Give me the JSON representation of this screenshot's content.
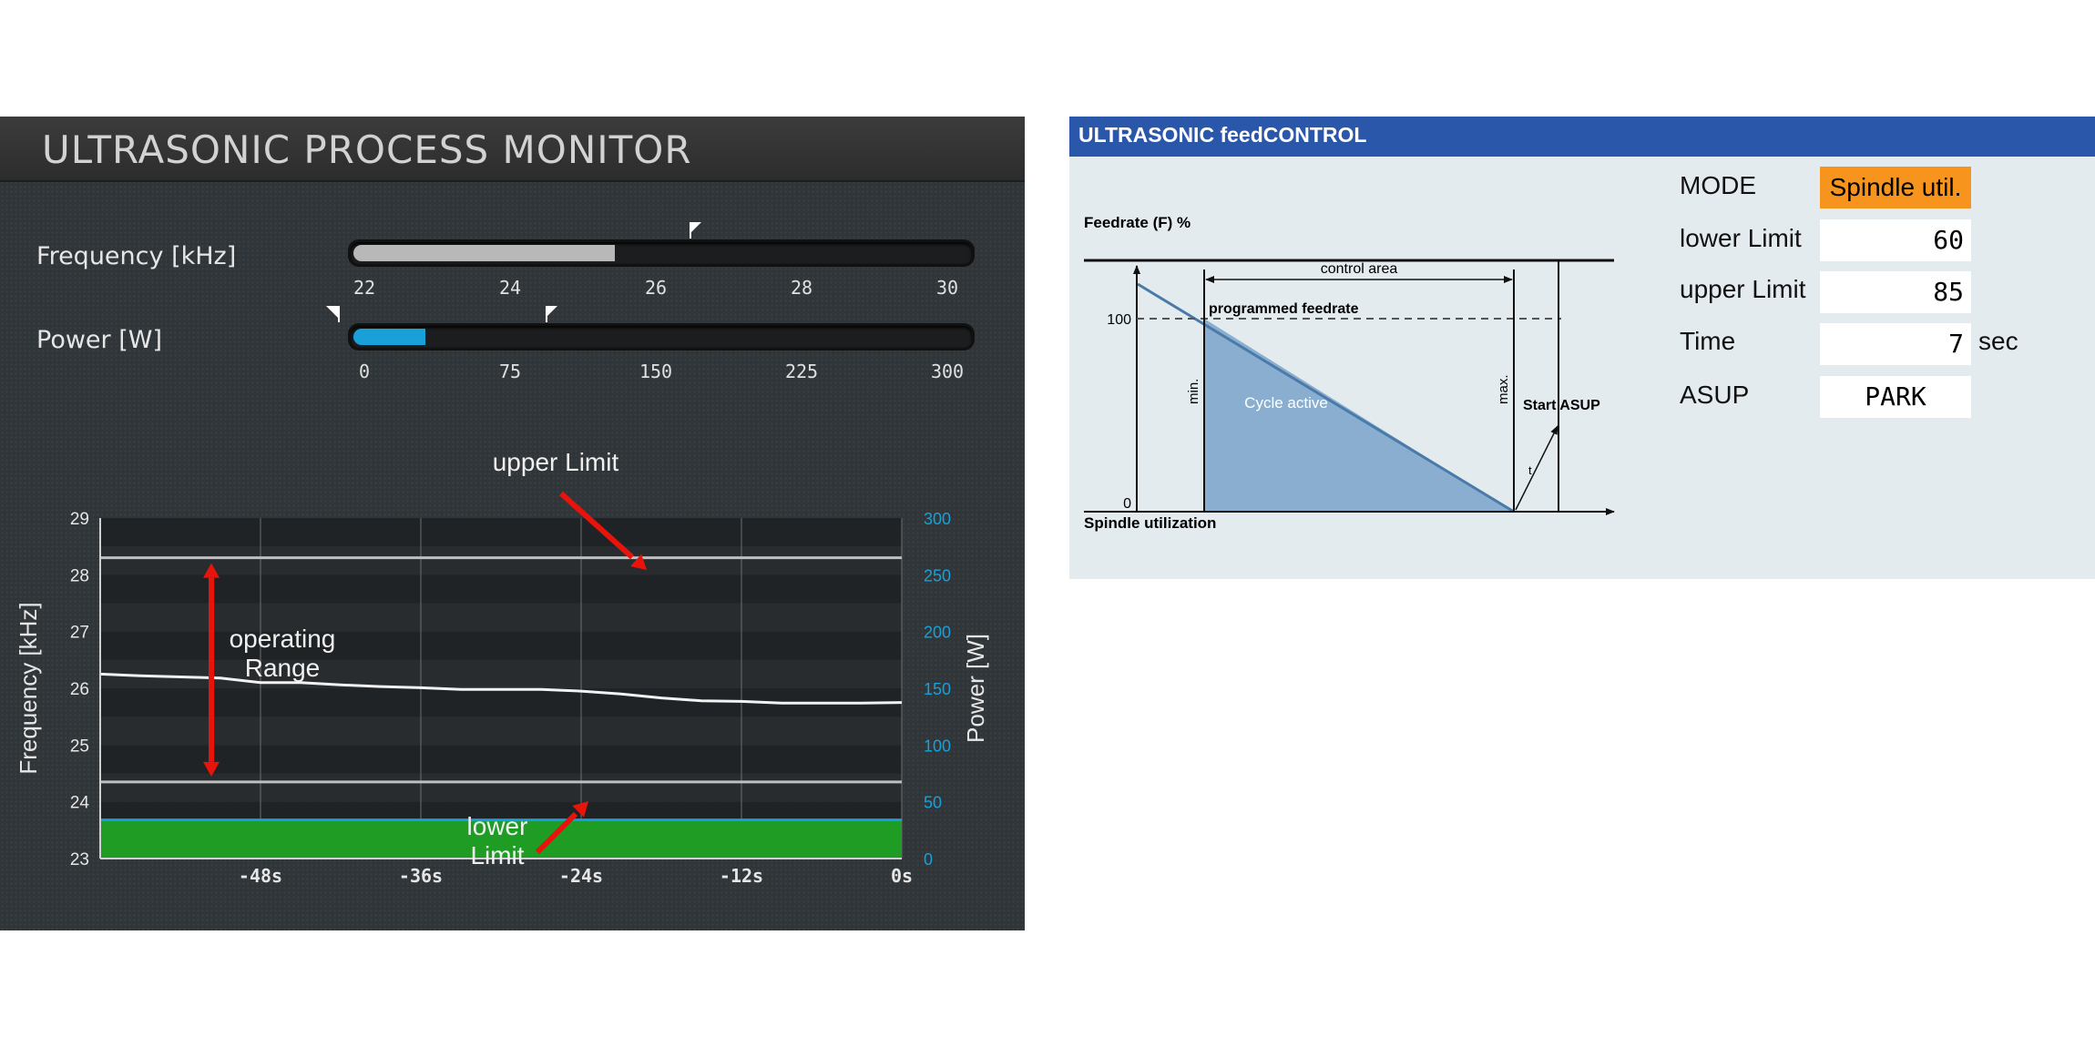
{
  "monitor": {
    "title": "ULTRASONIC PROCESS MONITOR",
    "frequency_gauge": {
      "label": "Frequency [kHz]",
      "ticks": [
        "22",
        "24",
        "26",
        "28",
        "30"
      ],
      "min": 22,
      "max": 30,
      "value": 25.4,
      "limit_marker": 26.4,
      "fill_color": "#b8b8b8"
    },
    "power_gauge": {
      "label": "Power [W]",
      "ticks": [
        "0",
        "75",
        "150",
        "225",
        "300"
      ],
      "min": 0,
      "max": 300,
      "value": 35,
      "lower_marker": 0,
      "upper_marker": 95,
      "fill_color": "#1aa0d8"
    },
    "annotations": {
      "upper_limit": "upper Limit",
      "operating_range_line1": "operating",
      "operating_range_line2": "Range",
      "lower_limit_line1": "lower",
      "lower_limit_line2": "Limit"
    },
    "colors": {
      "power_fill": "#1e9c23",
      "power_axis": "#1aa0d8",
      "arrow": "#e8140c"
    }
  },
  "chart_data": {
    "type": "line",
    "xlabel": "",
    "ylabel": "Frequency [kHz]",
    "y2label": "Power [W]",
    "x_ticks": [
      "-48s",
      "-36s",
      "-24s",
      "-12s",
      "0s"
    ],
    "xlim": [
      -60,
      0
    ],
    "ylim": [
      23,
      29
    ],
    "y_ticks": [
      "23",
      "24",
      "25",
      "26",
      "27",
      "28",
      "29"
    ],
    "y2lim": [
      0,
      300
    ],
    "y2_ticks": [
      "0",
      "50",
      "100",
      "150",
      "200",
      "250",
      "300"
    ],
    "upper_limit": 28.3,
    "lower_limit": 24.35,
    "series": [
      {
        "x": [
          -60,
          -57,
          -54,
          -51,
          -48,
          -45,
          -42,
          -39,
          -36,
          -33,
          -30,
          -27,
          -24,
          -21,
          -18,
          -15,
          -12,
          -9,
          -6,
          -3,
          0
        ],
        "values": [
          26.25,
          26.22,
          26.2,
          26.18,
          26.1,
          26.1,
          26.06,
          26.03,
          26.01,
          25.98,
          25.98,
          25.98,
          25.95,
          25.9,
          25.83,
          25.78,
          25.77,
          25.74,
          25.74,
          25.74,
          25.75
        ]
      },
      {
        "x": [
          -60,
          0
        ],
        "values": [
          34,
          34
        ]
      }
    ]
  },
  "feedcontrol": {
    "title": "ULTRASONIC feedCONTROL",
    "diagram": {
      "y_axis_label": "Feedrate (F) %",
      "x_axis_label": "Spindle utilization",
      "y100": "100",
      "y0": "0",
      "control_area": "control area",
      "programmed_feedrate": "programmed feedrate",
      "min": "min.",
      "max": "max.",
      "cycle_active": "Cycle active",
      "start_asup": "Start ASUP",
      "t": "t"
    },
    "params": {
      "mode_label": "MODE",
      "mode_value": "Spindle util.",
      "lower_label": "lower Limit",
      "lower_value": "60",
      "upper_label": "upper Limit",
      "upper_value": "85",
      "time_label": "Time",
      "time_value": "7",
      "time_unit": "sec",
      "asup_label": "ASUP",
      "asup_value": "PARK"
    }
  }
}
